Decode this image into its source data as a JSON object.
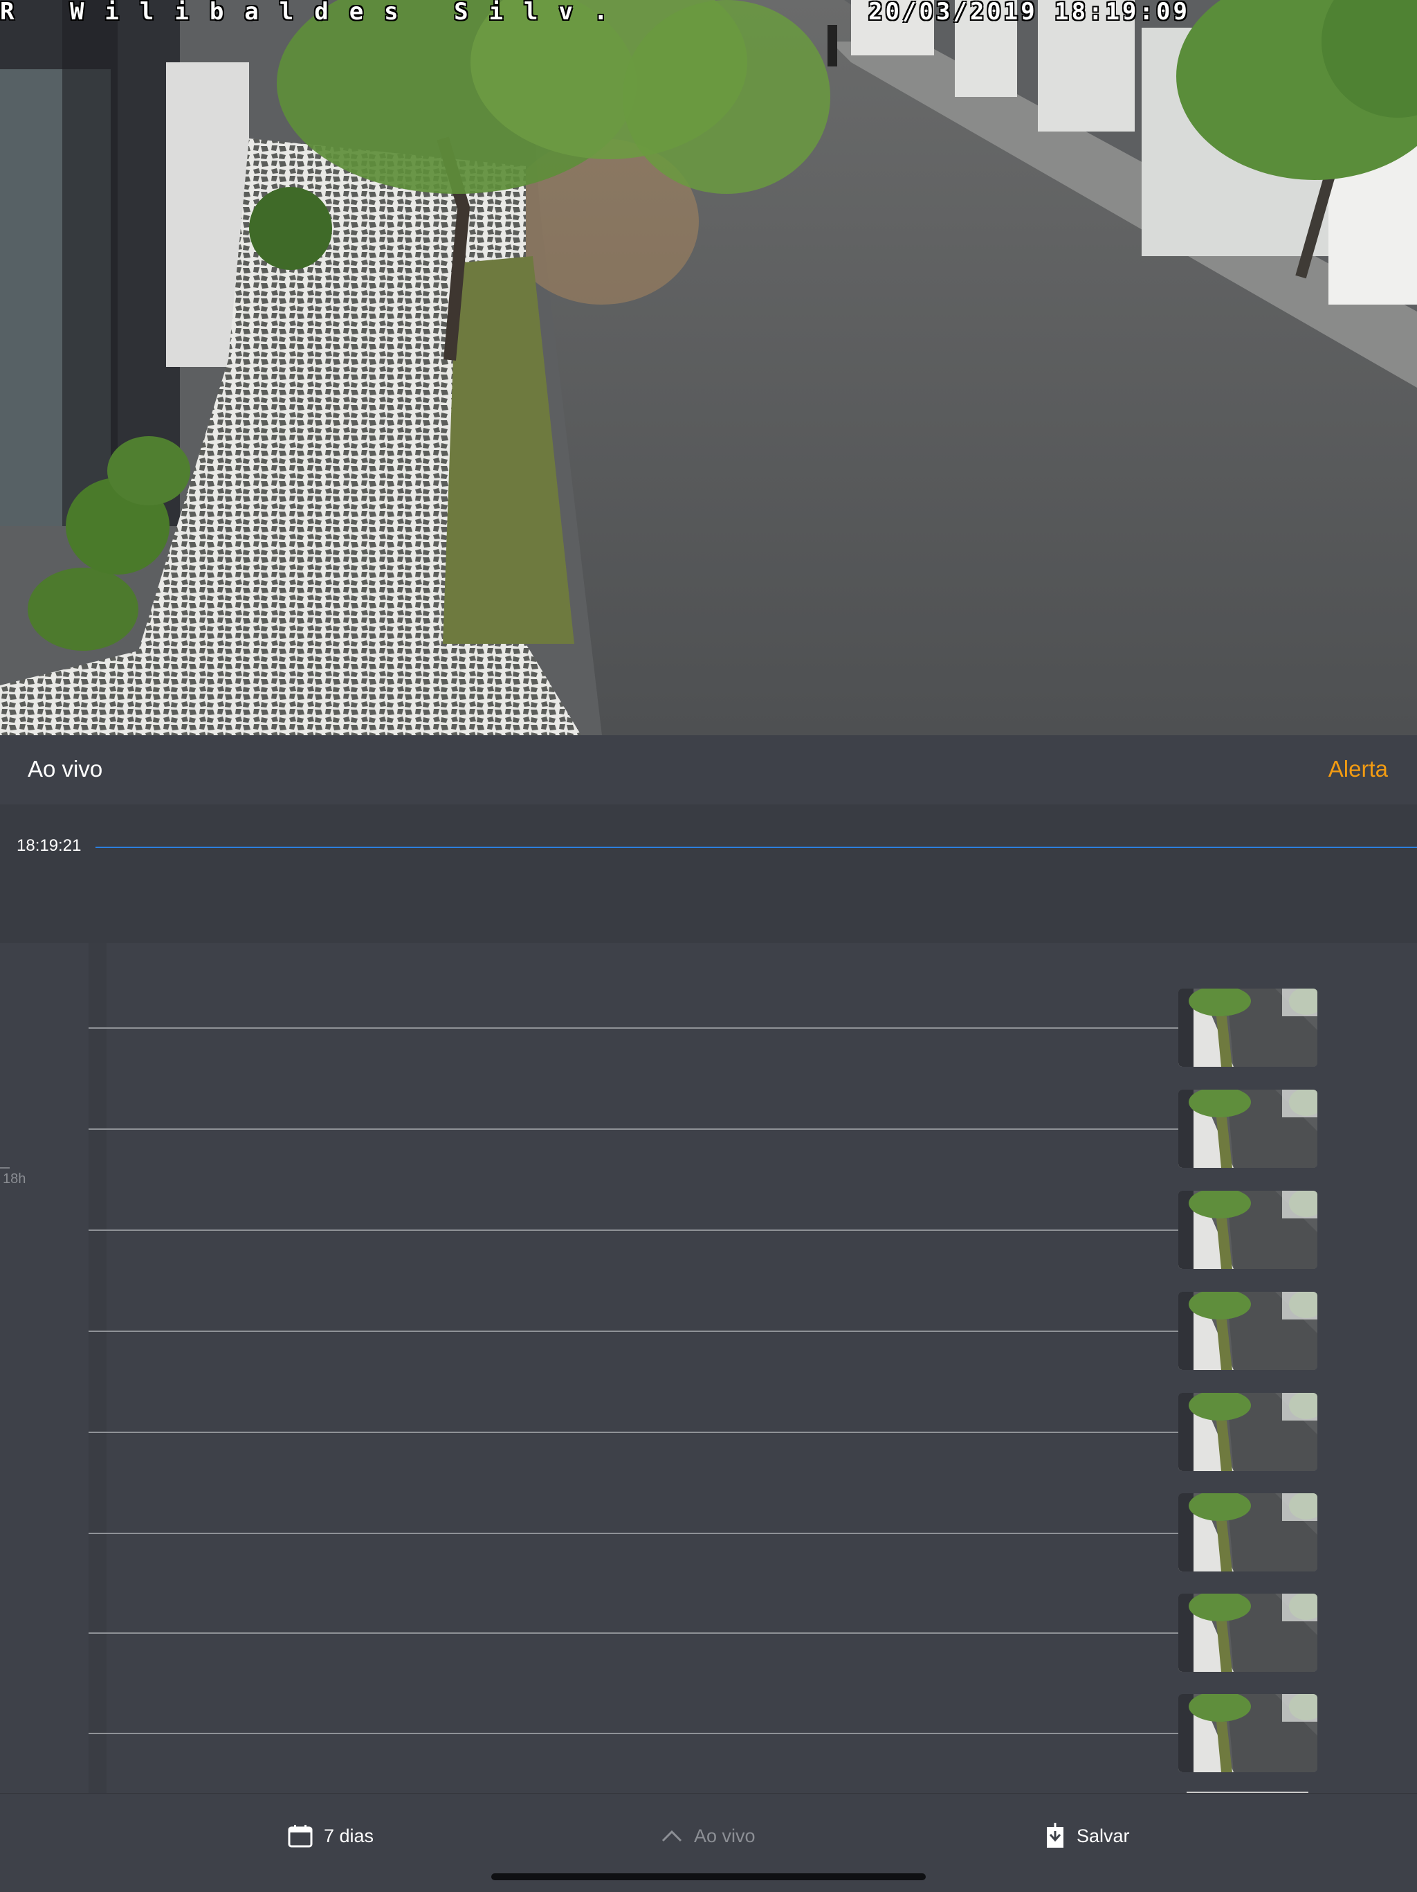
{
  "camera": {
    "osd_location": "R Wilibaldes Silv.",
    "osd_timestamp": "20/03/2019 18:19:09"
  },
  "header": {
    "title": "Ao vivo",
    "alert_label": "Alerta"
  },
  "timeline": {
    "current_time": "18:19:21",
    "hour_label": "18h",
    "event_count_visible": 8
  },
  "toolbar": {
    "days_label": "7 dias",
    "live_label": "Ao vivo",
    "save_label": "Salvar"
  },
  "icons": {
    "days": "calendar-icon",
    "live": "chevron-up-icon",
    "save": "download-icon"
  },
  "colors": {
    "accent_alert": "#f29b12",
    "now_line": "#2b7fde",
    "background": "#3e4149"
  }
}
